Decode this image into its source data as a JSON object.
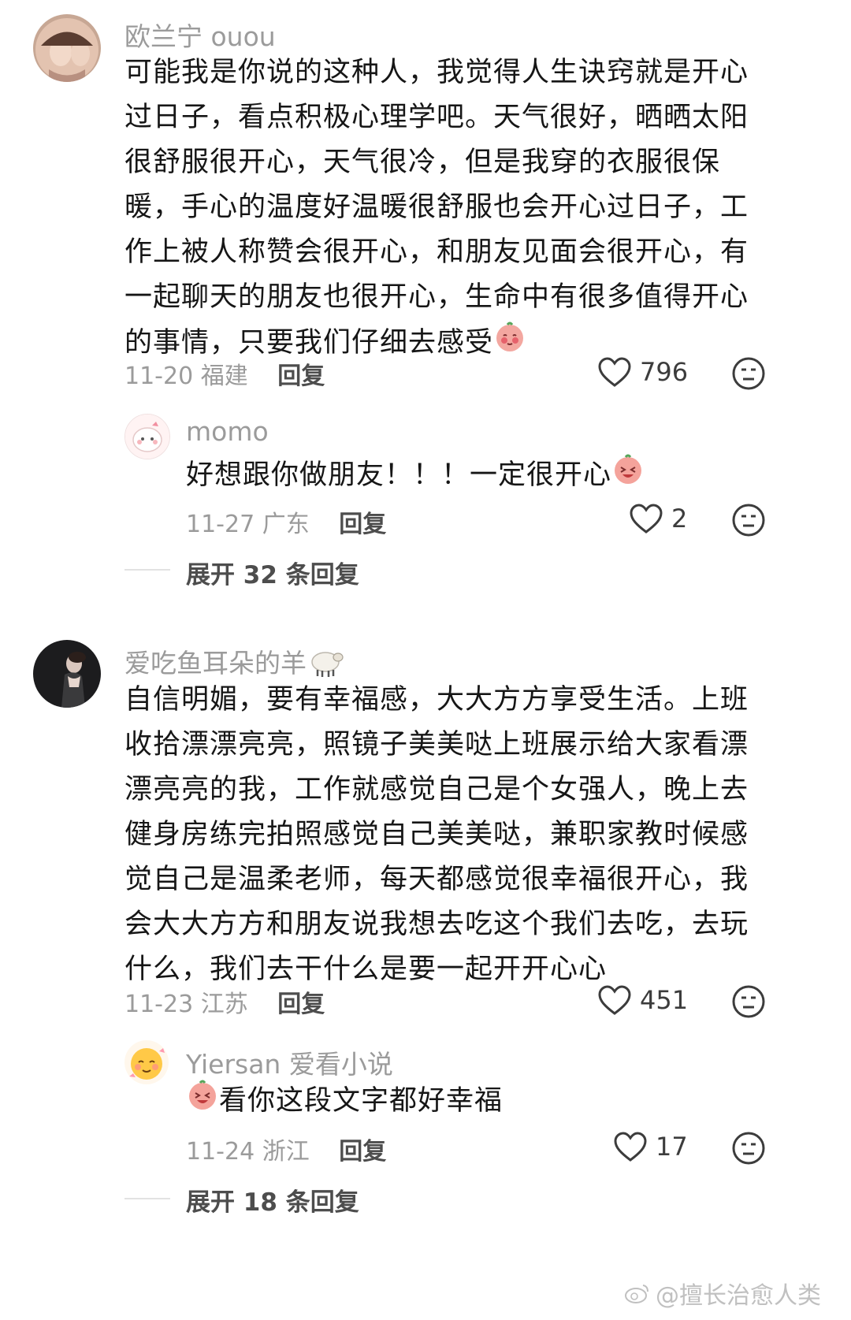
{
  "comments": [
    {
      "username": "欧兰宁 ouou",
      "text": "可能我是你说的这种人，我觉得人生诀窍就是开心过日子，看点积极心理学吧。天气很好，晒晒太阳很舒服很开心，天气很冷，但是我穿的衣服很保暖，手心的温度好温暖很舒服也会开心过日子，工作上被人称赞会很开心，和朋友见面会很开心，有一起聊天的朋友也很开心，生命中有很多值得开心的事情，只要我们仔细去感受",
      "date": "11-20",
      "location": "福建",
      "reply_label": "回复",
      "likes": "796",
      "replies": [
        {
          "username": "momo",
          "text": "好想跟你做朋友！！！一定很开心",
          "date": "11-27",
          "location": "广东",
          "reply_label": "回复",
          "likes": "2"
        }
      ],
      "expand_label": "展开 32 条回复"
    },
    {
      "username": "爱吃鱼耳朵的羊",
      "text": "自信明媚，要有幸福感，大大方方享受生活。上班收拾漂漂亮亮，照镜子美美哒上班展示给大家看漂漂亮亮的我，工作就感觉自己是个女强人，晚上去健身房练完拍照感觉自己美美哒，兼职家教时候感觉自己是温柔老师，每天都感觉很幸福很开心，我会大大方方和朋友说我想去吃这个我们去吃，去玩什么，我们去干什么是要一起开开心心",
      "date": "11-23",
      "location": "江苏",
      "reply_label": "回复",
      "likes": "451",
      "replies": [
        {
          "username": "Yiersan 爱看小说",
          "text": "看你这段文字都好幸福",
          "date": "11-24",
          "location": "浙江",
          "reply_label": "回复",
          "likes": "17"
        }
      ],
      "expand_label": "展开 18 条回复"
    }
  ],
  "icons": {
    "like": "heart-outline-icon",
    "dislike": "neutral-face-icon",
    "sheep": "sheep-emoji",
    "blush": "blush-emoji",
    "laugh": "laugh-emoji"
  },
  "watermark": "@擅长治愈人类"
}
